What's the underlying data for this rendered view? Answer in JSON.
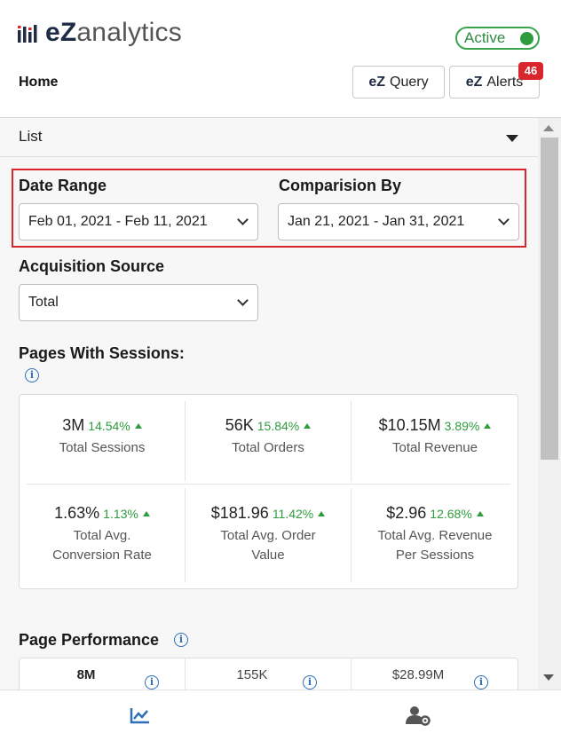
{
  "header": {
    "logo_ez": "eZ",
    "logo_rest": "analytics",
    "status_label": "Active",
    "home_label": "Home",
    "query_prefix": "eZ",
    "query_label": "Query",
    "alerts_prefix": "eZ",
    "alerts_label": "Alerts",
    "alerts_count": "46"
  },
  "view_select": {
    "value": "List"
  },
  "filters": {
    "date_range_label": "Date Range",
    "date_range_value": "Feb 01, 2021 - Feb 11, 2021",
    "comparison_label": "Comparision By",
    "comparison_value": "Jan 21, 2021 - Jan 31, 2021",
    "acquisition_label": "Acquisition Source",
    "acquisition_value": "Total"
  },
  "sessions_section": {
    "title": "Pages With Sessions:",
    "metrics": [
      {
        "value": "3M",
        "change": "14.54%",
        "label": "Total Sessions"
      },
      {
        "value": "56K",
        "change": "15.84%",
        "label": "Total Orders"
      },
      {
        "value": "$10.15M",
        "change": "3.89%",
        "label": "Total Revenue"
      },
      {
        "value": "1.63%",
        "change": "1.13%",
        "label_line1": "Total Avg.",
        "label_line2": "Conversion Rate"
      },
      {
        "value": "$181.96",
        "change": "11.42%",
        "label_line1": "Total Avg. Order",
        "label_line2": "Value"
      },
      {
        "value": "$2.96",
        "change": "12.68%",
        "label_line1": "Total Avg. Revenue",
        "label_line2": "Per Sessions"
      }
    ]
  },
  "performance_section": {
    "title": "Page Performance",
    "values": [
      "8M",
      "155K",
      "$28.99M"
    ]
  },
  "bottom_nav": {
    "items": [
      {
        "icon": "chart-icon",
        "active": true
      },
      {
        "icon": "user-settings-icon",
        "active": false
      }
    ]
  },
  "colors": {
    "accent_red": "#d9262c",
    "positive_green": "#2e9c3f",
    "info_blue": "#2d6fb8",
    "nav_active_blue": "#2d6fb8"
  }
}
